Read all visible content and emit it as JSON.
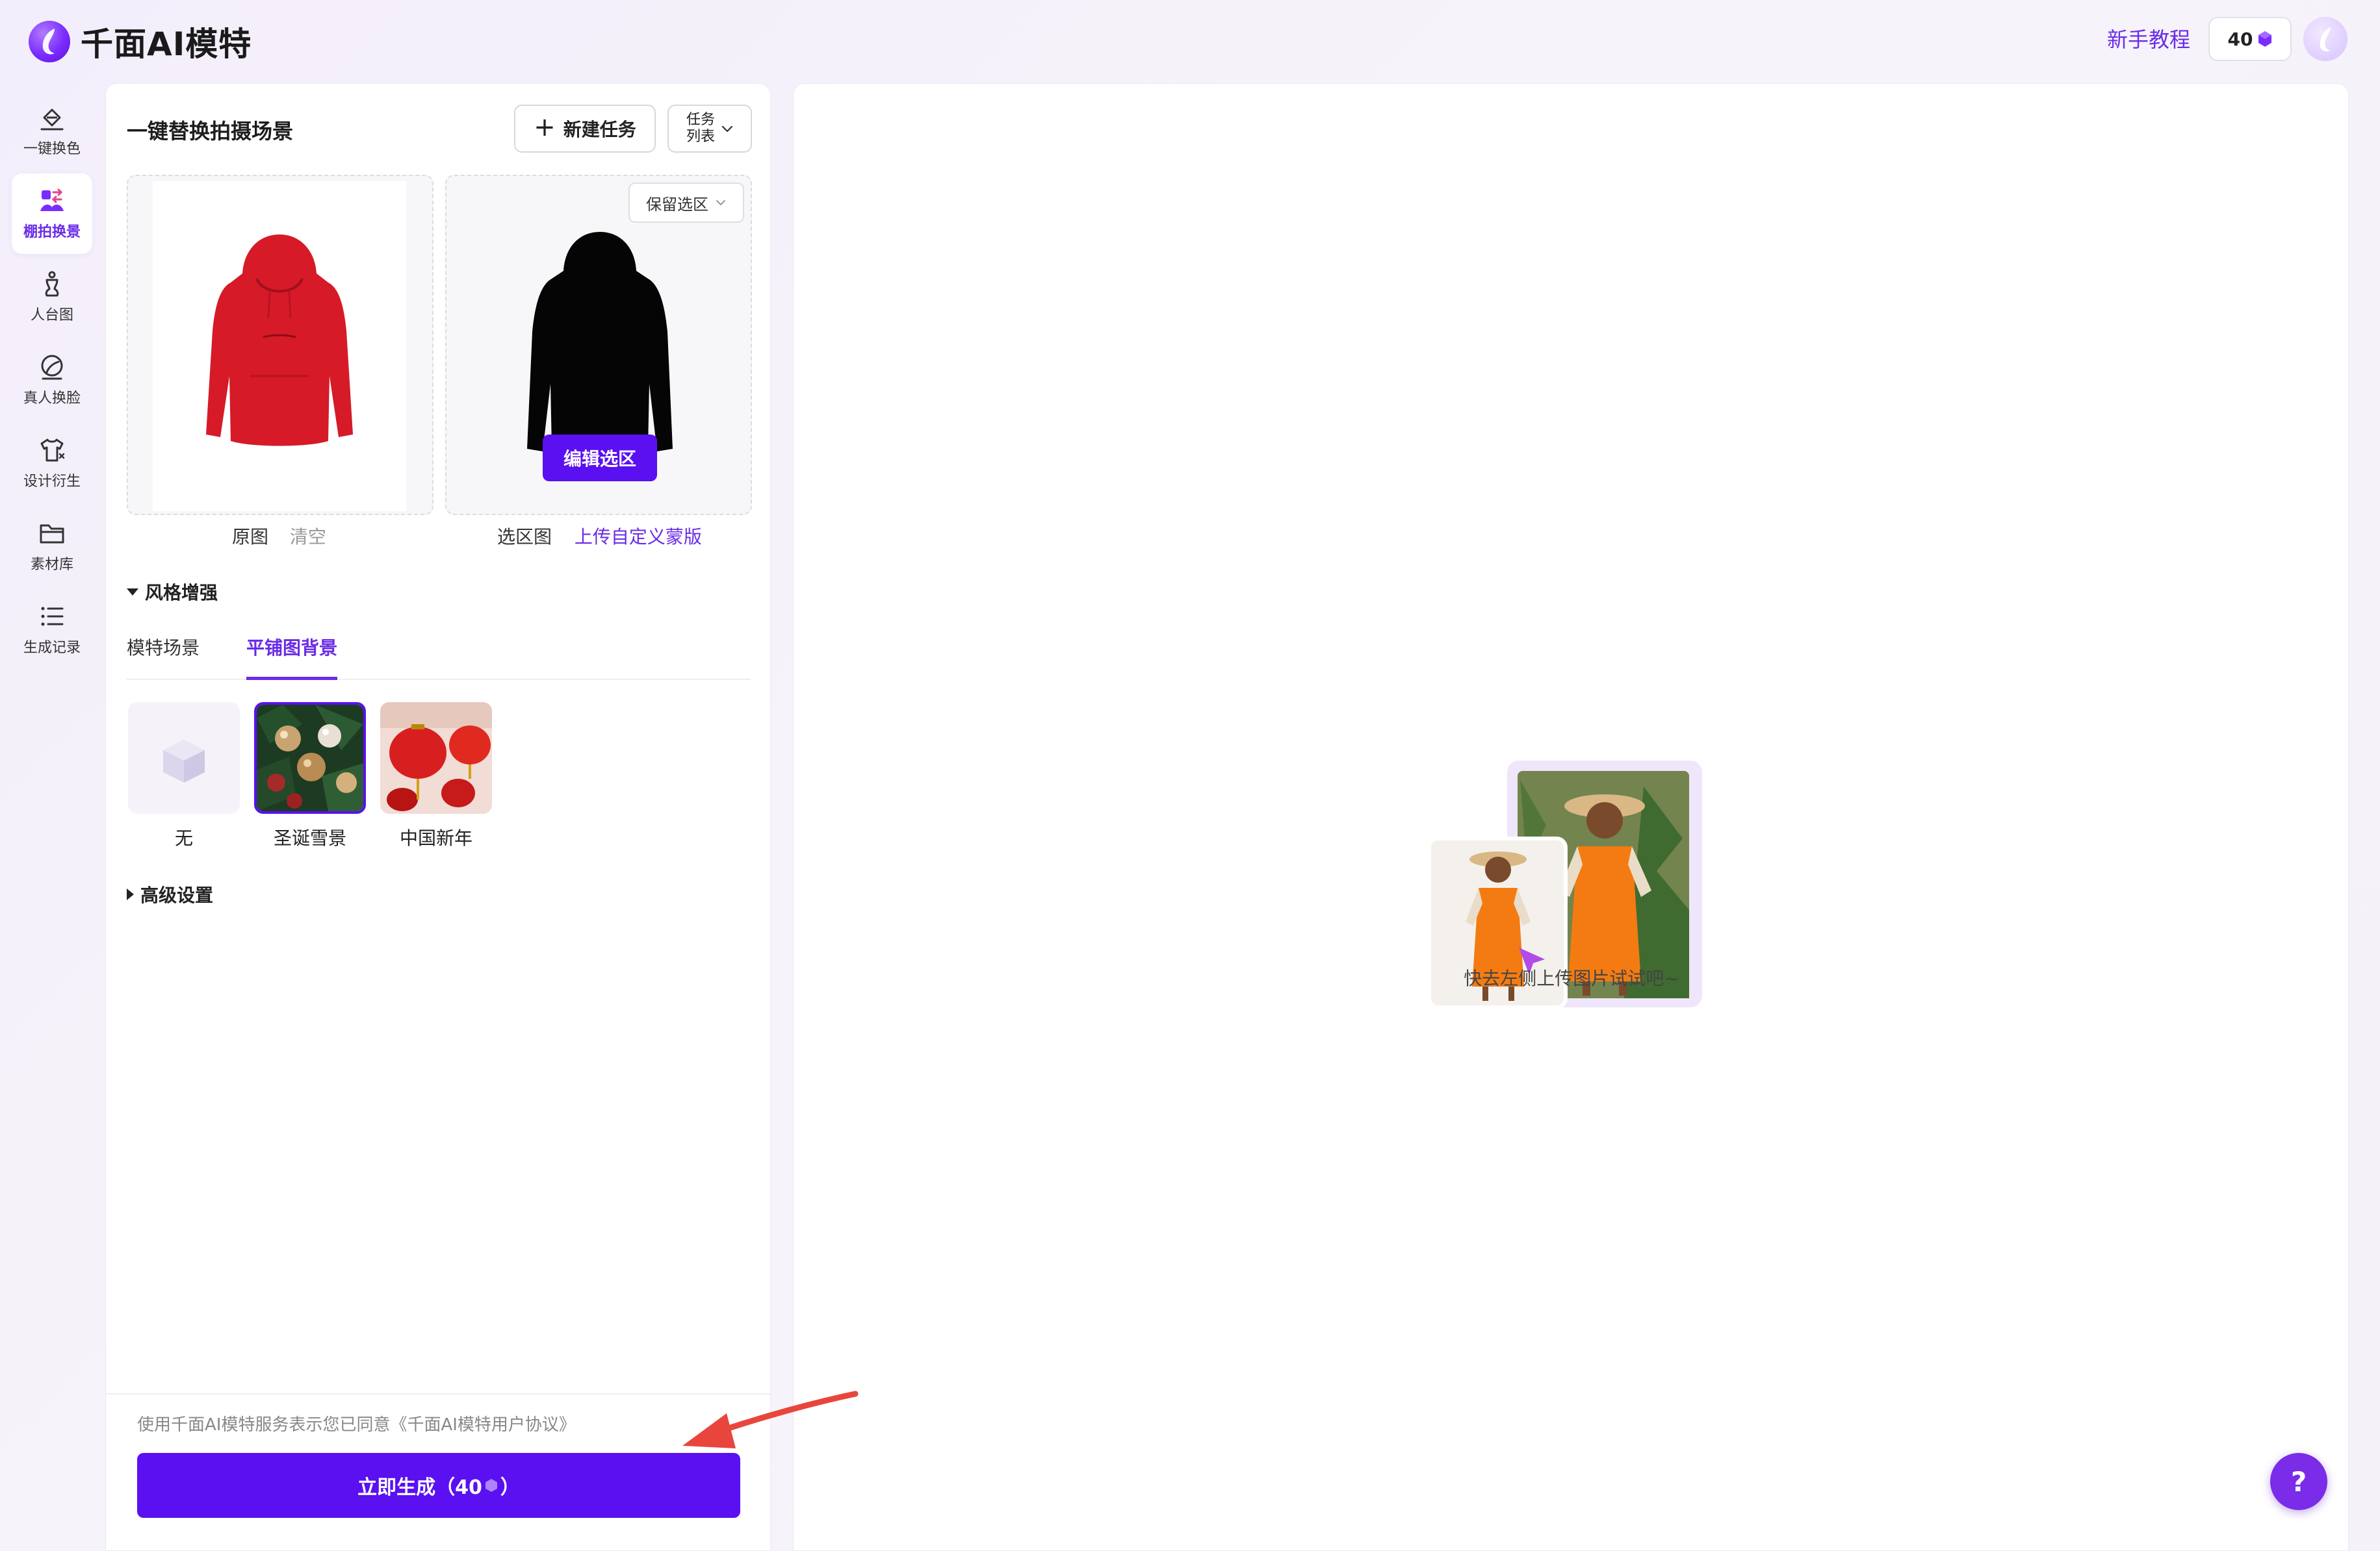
{
  "app": {
    "title": "千面AI模特",
    "tutorial_label": "新手教程",
    "credits": "40"
  },
  "sidebar": {
    "items": [
      {
        "label": "一键换色",
        "icon": "paint-bucket-icon",
        "active": false
      },
      {
        "label": "棚拍换景",
        "icon": "scene-swap-icon",
        "active": true
      },
      {
        "label": "人台图",
        "icon": "mannequin-icon",
        "active": false
      },
      {
        "label": "真人换脸",
        "icon": "face-swap-icon",
        "active": false
      },
      {
        "label": "设计衍生",
        "icon": "tshirt-icon",
        "active": false
      },
      {
        "label": "素材库",
        "icon": "folder-icon",
        "active": false
      },
      {
        "label": "生成记录",
        "icon": "list-icon",
        "active": false
      }
    ]
  },
  "panel": {
    "title": "一键替换拍摄场景",
    "new_task_label": "新建任务",
    "task_list_label": "任务列表",
    "keep_select_label": "保留选区",
    "edit_select_label": "编辑选区",
    "original_label": "原图",
    "clear_label": "清空",
    "mask_label": "选区图",
    "upload_mask_label": "上传自定义蒙版",
    "style_section": "风格增强",
    "tabs": [
      "模特场景",
      "平铺图背景"
    ],
    "active_tab": 1,
    "presets": [
      "无",
      "圣诞雪景",
      "中国新年"
    ],
    "selected_preset": 1,
    "advanced_section": "高级设置",
    "agreement": "使用千面AI模特服务表示您已同意《千面AI模特用户协议》",
    "generate_label": "立即生成（40",
    "generate_suffix": "）"
  },
  "canvas": {
    "empty_text": "快去左侧上传图片试试吧~",
    "help_label": "?"
  },
  "colors": {
    "accent": "#5a10f0",
    "accent_text": "#6a2ce8",
    "hoodie": "#d61a28",
    "annotation": "#e8463c"
  }
}
